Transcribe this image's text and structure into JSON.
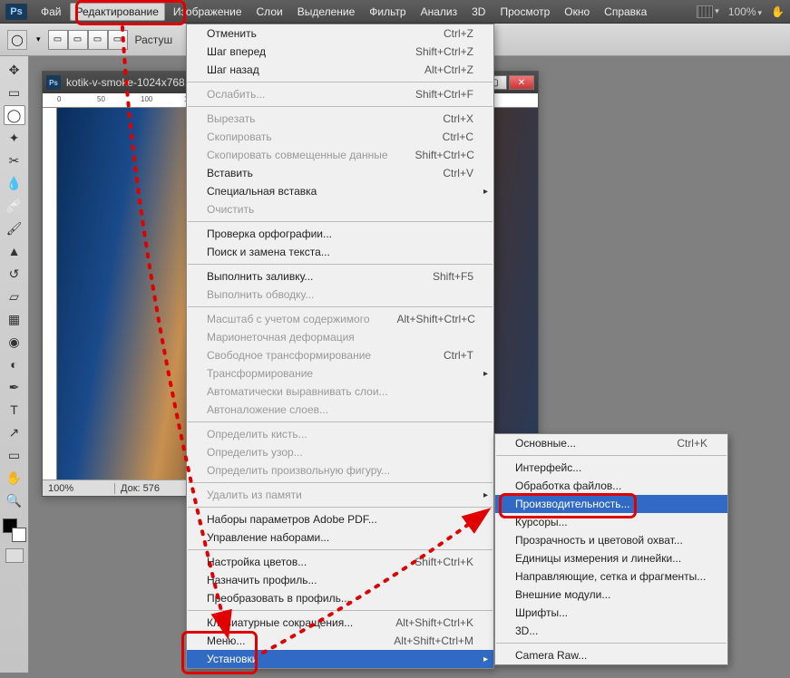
{
  "app": {
    "logo": "Ps",
    "zoom_pct": "100%"
  },
  "menubar": {
    "items": [
      "Фай",
      "Редактирование",
      "Изображение",
      "Слои",
      "Выделение",
      "Фильтр",
      "Анализ",
      "3D",
      "Просмотр",
      "Окно",
      "Справка"
    ]
  },
  "optionsbar": {
    "feather_label": "Растуш"
  },
  "document": {
    "title": "kotik-v-smoke-1024x768.j...",
    "zoom": "100%",
    "docinfo": "Док: 576"
  },
  "edit_menu": {
    "groups": [
      [
        {
          "label": "Отменить",
          "shortcut": "Ctrl+Z"
        },
        {
          "label": "Шаг вперед",
          "shortcut": "Shift+Ctrl+Z"
        },
        {
          "label": "Шаг назад",
          "shortcut": "Alt+Ctrl+Z"
        }
      ],
      [
        {
          "label": "Ослабить...",
          "shortcut": "Shift+Ctrl+F",
          "disabled": true
        }
      ],
      [
        {
          "label": "Вырезать",
          "shortcut": "Ctrl+X",
          "disabled": true
        },
        {
          "label": "Скопировать",
          "shortcut": "Ctrl+C",
          "disabled": true
        },
        {
          "label": "Скопировать совмещенные данные",
          "shortcut": "Shift+Ctrl+C",
          "disabled": true
        },
        {
          "label": "Вставить",
          "shortcut": "Ctrl+V"
        },
        {
          "label": "Специальная вставка",
          "arrow": true
        },
        {
          "label": "Очистить",
          "disabled": true
        }
      ],
      [
        {
          "label": "Проверка орфографии..."
        },
        {
          "label": "Поиск и замена текста..."
        }
      ],
      [
        {
          "label": "Выполнить заливку...",
          "shortcut": "Shift+F5"
        },
        {
          "label": "Выполнить обводку...",
          "disabled": true
        }
      ],
      [
        {
          "label": "Масштаб с учетом содержимого",
          "shortcut": "Alt+Shift+Ctrl+C",
          "disabled": true
        },
        {
          "label": "Марионеточная деформация",
          "disabled": true
        },
        {
          "label": "Свободное трансформирование",
          "shortcut": "Ctrl+T",
          "disabled": true
        },
        {
          "label": "Трансформирование",
          "arrow": true,
          "disabled": true
        },
        {
          "label": "Автоматически выравнивать слои...",
          "disabled": true
        },
        {
          "label": "Автоналожение слоев...",
          "disabled": true
        }
      ],
      [
        {
          "label": "Определить кисть...",
          "disabled": true
        },
        {
          "label": "Определить узор...",
          "disabled": true
        },
        {
          "label": "Определить произвольную фигуру...",
          "disabled": true
        }
      ],
      [
        {
          "label": "Удалить из памяти",
          "arrow": true,
          "disabled": true
        }
      ],
      [
        {
          "label": "Наборы параметров Adobe PDF..."
        },
        {
          "label": "Управление наборами..."
        }
      ],
      [
        {
          "label": "Настройка цветов...",
          "shortcut": "Shift+Ctrl+K"
        },
        {
          "label": "Назначить профиль..."
        },
        {
          "label": "Преобразовать в профиль..."
        }
      ],
      [
        {
          "label": "Клавиатурные сокращения...",
          "shortcut": "Alt+Shift+Ctrl+K"
        },
        {
          "label": "Меню...",
          "shortcut": "Alt+Shift+Ctrl+M"
        },
        {
          "label": "Установки",
          "arrow": true,
          "highlight": true
        }
      ]
    ]
  },
  "prefs_submenu": {
    "groups": [
      [
        {
          "label": "Основные...",
          "shortcut": "Ctrl+K"
        }
      ],
      [
        {
          "label": "Интерфейс..."
        },
        {
          "label": "Обработка файлов..."
        },
        {
          "label": "Производительность...",
          "highlight": true
        },
        {
          "label": "Курсоры..."
        },
        {
          "label": "Прозрачность и цветовой охват..."
        },
        {
          "label": "Единицы измерения и линейки..."
        },
        {
          "label": "Направляющие, сетка и фрагменты..."
        },
        {
          "label": "Внешние модули..."
        },
        {
          "label": "Шрифты..."
        },
        {
          "label": "3D..."
        }
      ],
      [
        {
          "label": "Camera Raw..."
        }
      ]
    ]
  },
  "tools": [
    "move",
    "marquee",
    "lasso",
    "wand",
    "crop",
    "eyedrop",
    "heal",
    "brush",
    "stamp",
    "history",
    "eraser",
    "gradient",
    "blur",
    "dodge",
    "pen",
    "type",
    "path",
    "rect",
    "hand",
    "zoom"
  ]
}
